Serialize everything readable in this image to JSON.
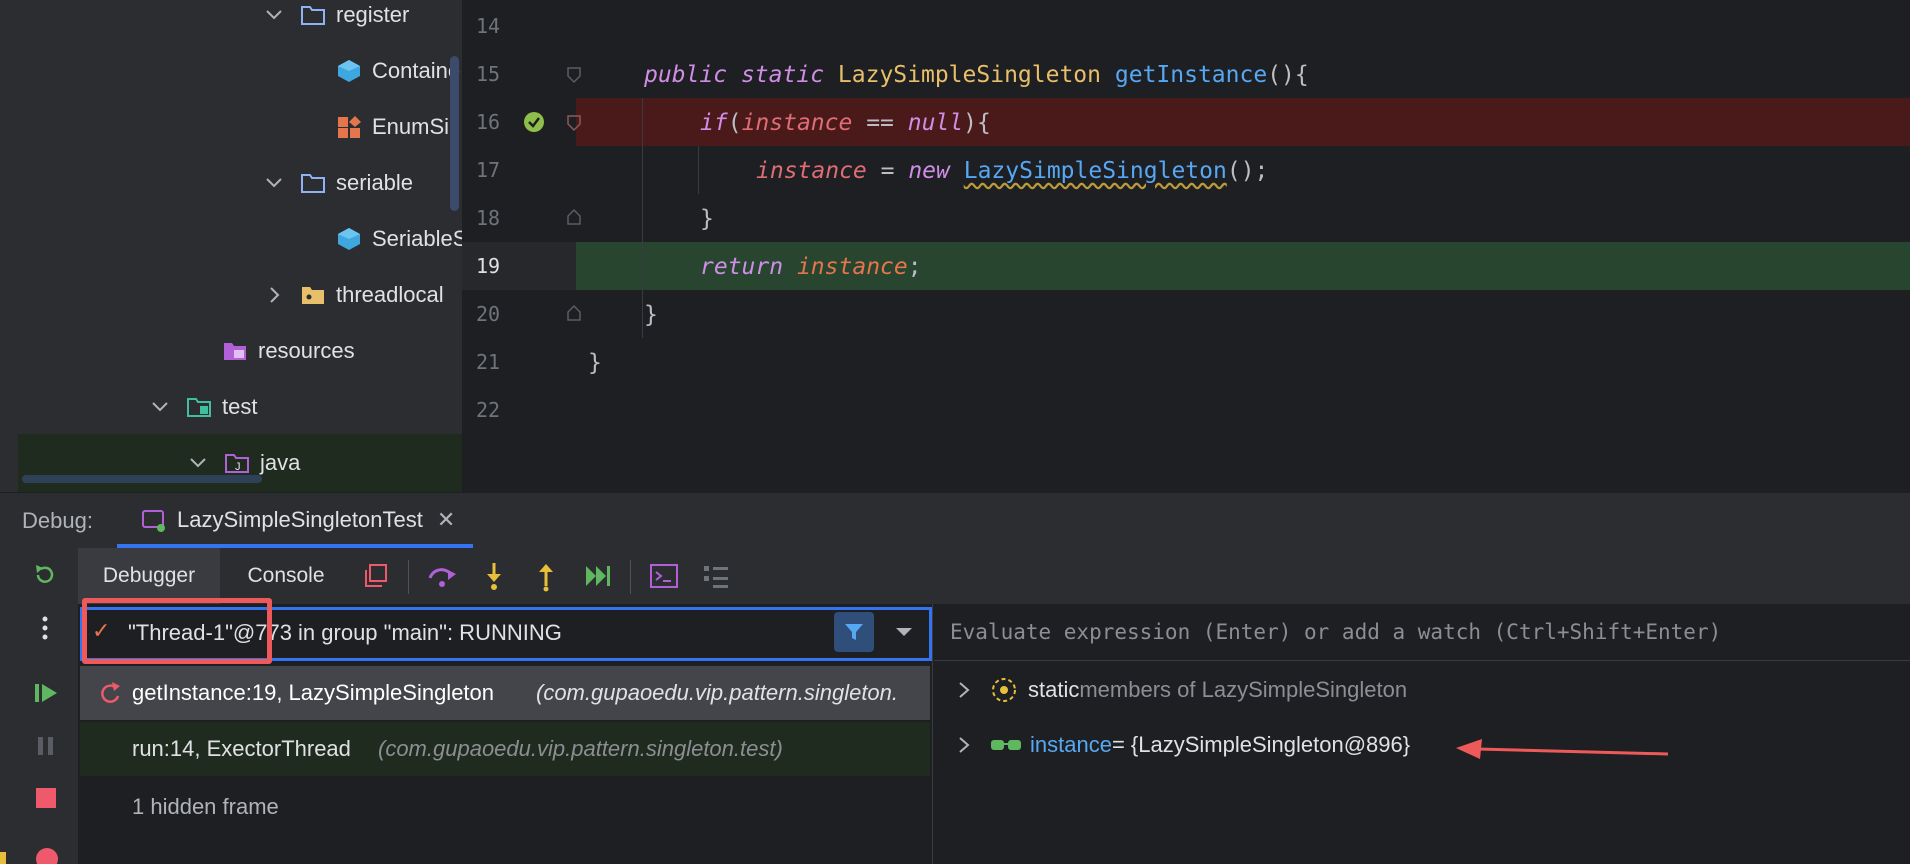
{
  "project_tree": {
    "items": [
      {
        "label": "register",
        "type": "folder",
        "expanded": true
      },
      {
        "label": "Containe",
        "type": "class"
      },
      {
        "label": "EnumSi",
        "type": "enum"
      },
      {
        "label": "seriable",
        "type": "folder",
        "expanded": true
      },
      {
        "label": "SeriableS",
        "type": "class"
      },
      {
        "label": "threadlocal",
        "type": "package",
        "expanded": false
      },
      {
        "label": "resources",
        "type": "resources-folder"
      },
      {
        "label": "test",
        "type": "test-folder",
        "expanded": true
      },
      {
        "label": "java",
        "type": "test-source-folder",
        "expanded": true
      }
    ]
  },
  "editor": {
    "line_numbers": [
      "14",
      "15",
      "16",
      "17",
      "18",
      "19",
      "20",
      "21",
      "22"
    ],
    "current_line": "19",
    "breakpoint_line": "16",
    "code": {
      "l15_kw1": "public",
      "l15_kw2": "static",
      "l15_type": "LazySimpleSingleton",
      "l15_method": "getInstance",
      "l15_tail": "(){",
      "l16_kw": "if",
      "l16_open": "(",
      "l16_var": "instance",
      "l16_op": " == ",
      "l16_null": "null",
      "l16_tail": "){",
      "l17_var": "instance",
      "l17_op": " = ",
      "l17_new": "new",
      "l17_type": "LazySimpleSingleton",
      "l17_tail": "();",
      "l18": "}",
      "l19_kw": "return",
      "l19_var": "instance",
      "l19_tail": ";",
      "l20": "}",
      "l21": "}"
    },
    "colors": {
      "breakpoint_bg": "#4a1a1a",
      "current_bg": "#27452f"
    }
  },
  "debug": {
    "label": "Debug:",
    "session_tab": "LazySimpleSingletonTest",
    "tabs": [
      "Debugger",
      "Console"
    ],
    "thread": "\"Thread-1\"@773 in group \"main\": RUNNING",
    "frames": [
      {
        "method": "getInstance:19, LazySimpleSingleton",
        "package": "(com.gupaoedu.vip.pattern.singleton."
      },
      {
        "method": "run:14, ExectorThread",
        "package": "(com.gupaoedu.vip.pattern.singleton.test)"
      }
    ],
    "hidden_frames": "1 hidden frame",
    "eval_placeholder": "Evaluate expression (Enter) or add a watch (Ctrl+Shift+Enter)",
    "variables": {
      "static_prefix": "static",
      "static_rest": " members of LazySimpleSingleton",
      "instance_name": "instance",
      "instance_value": " = {LazySimpleSingleton@896}"
    },
    "annotation_color": "#ee5a5a"
  }
}
